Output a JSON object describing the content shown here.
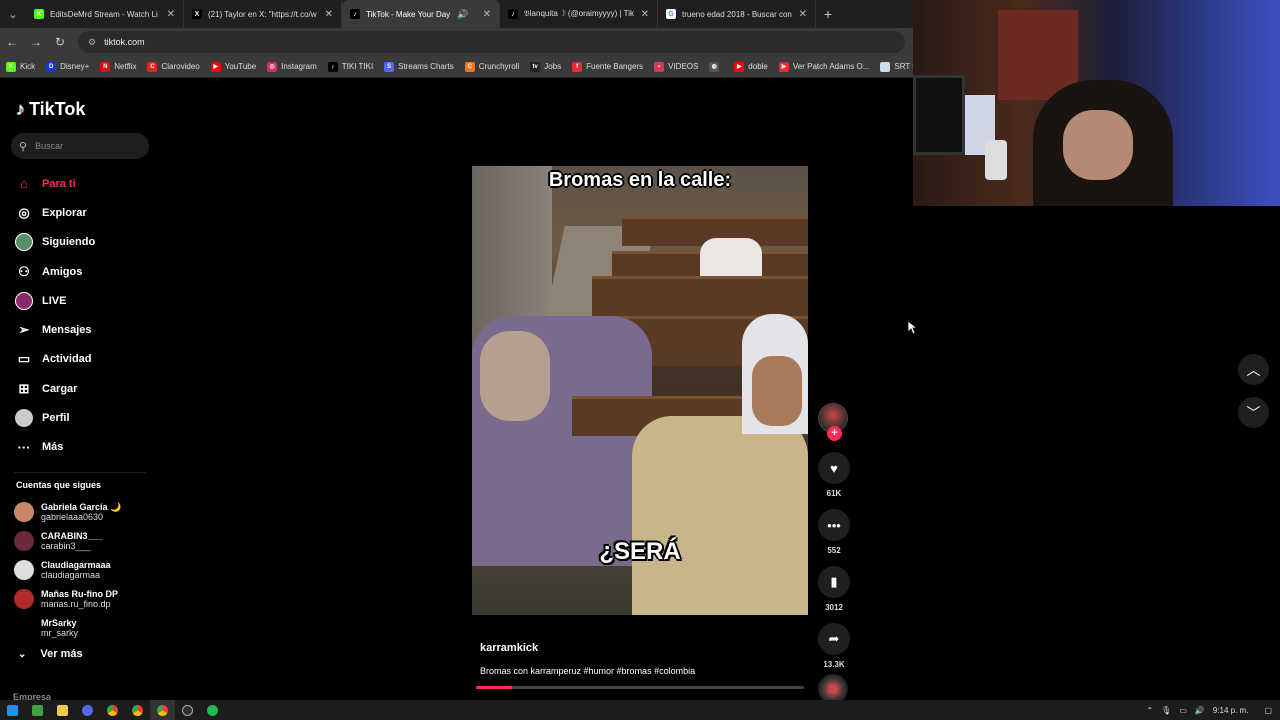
{
  "browser": {
    "tabs": [
      {
        "title": "EditsDeMrd Stream - Watch Li",
        "icon": "kick-icon",
        "color": "#53fc18",
        "glyph": "K",
        "active": false
      },
      {
        "title": "(21) Taylor en X: \"https://t.co/w",
        "icon": "x-icon",
        "color": "#000000",
        "glyph": "X",
        "active": false
      },
      {
        "title": "TikTok - Make Your Day",
        "icon": "tiktok-icon",
        "color": "#000000",
        "glyph": "♪",
        "active": true
      },
      {
        "title": "𝔅lanquita ☽ (@oraimyyyy) | Tik",
        "icon": "tiktok-icon",
        "color": "#000000",
        "glyph": "♪",
        "active": false
      },
      {
        "title": "trueno edad 2018 - Buscar con",
        "icon": "google-icon",
        "color": "#ffffff",
        "glyph": "G",
        "active": false
      }
    ],
    "url": "tiktok.com",
    "bookmarks": [
      {
        "label": "Kick",
        "color": "#53fc18",
        "glyph": "K"
      },
      {
        "label": "Disney+",
        "color": "#113ccf",
        "glyph": "D"
      },
      {
        "label": "Netflix",
        "color": "#e50914",
        "glyph": "N"
      },
      {
        "label": "Clarovideo",
        "color": "#da291c",
        "glyph": "C"
      },
      {
        "label": "YouTube",
        "color": "#ff0000",
        "glyph": "▶"
      },
      {
        "label": "Instagram",
        "color": "#d62976",
        "glyph": "◎"
      },
      {
        "label": "TIKI TIKI",
        "color": "#000000",
        "glyph": "♪"
      },
      {
        "label": "Streams Charts",
        "color": "#5566ff",
        "glyph": "S"
      },
      {
        "label": "Crunchyroll",
        "color": "#f47521",
        "glyph": "C"
      },
      {
        "label": "Jobs",
        "color": "#222222",
        "glyph": "tv"
      },
      {
        "label": "Fuente Bangers",
        "color": "#e03030",
        "glyph": "f"
      },
      {
        "label": "VIDEOS",
        "color": "#d23c5a",
        "glyph": "▪"
      },
      {
        "label": "",
        "color": "#555555",
        "glyph": "◍"
      },
      {
        "label": "doble",
        "color": "#ff0000",
        "glyph": "▶"
      },
      {
        "label": "Ver Patch Adams O...",
        "color": "#e03030",
        "glyph": "▶"
      },
      {
        "label": "SRT Mi",
        "color": "#ccddee",
        "glyph": "◌"
      }
    ]
  },
  "tiktok": {
    "logo": "TikTok",
    "search_placeholder": "Buscar",
    "nav": [
      {
        "label": "Para ti",
        "name": "nav-para-ti",
        "icon": "home-icon",
        "glyph": "⌂",
        "active": true
      },
      {
        "label": "Explorar",
        "name": "nav-explorar",
        "icon": "compass-icon",
        "glyph": "◎",
        "active": false
      },
      {
        "label": "Siguiendo",
        "name": "nav-siguiendo",
        "icon": "following-avatar-icon",
        "glyph": "",
        "active": false
      },
      {
        "label": "Amigos",
        "name": "nav-amigos",
        "icon": "friends-icon",
        "glyph": "⚇",
        "active": false
      },
      {
        "label": "LIVE",
        "name": "nav-live",
        "icon": "live-avatar-icon",
        "glyph": "",
        "active": false
      },
      {
        "label": "Mensajes",
        "name": "nav-mensajes",
        "icon": "paper-plane-icon",
        "glyph": "➢",
        "active": false
      },
      {
        "label": "Actividad",
        "name": "nav-actividad",
        "icon": "activity-icon",
        "glyph": "▭",
        "active": false
      },
      {
        "label": "Cargar",
        "name": "nav-cargar",
        "icon": "upload-icon",
        "glyph": "⊞",
        "active": false
      },
      {
        "label": "Perfil",
        "name": "nav-perfil",
        "icon": "profile-avatar-icon",
        "glyph": "",
        "active": false
      },
      {
        "label": "Más",
        "name": "nav-mas",
        "icon": "more-icon",
        "glyph": "···",
        "active": false
      }
    ],
    "following_title": "Cuentas que sigues",
    "following": [
      {
        "name": "Gabriela García 🌙",
        "user": "gabrielaaa0630",
        "color": "#c98a6a"
      },
      {
        "name": "CARABIN3___",
        "user": "carabin3___",
        "color": "#6a2a3a"
      },
      {
        "name": "Claudiagarmaaa",
        "user": "claudiagarmaa",
        "color": "#dddddd"
      },
      {
        "name": "Mañas Ru-fino DP",
        "user": "manas.ru_fino.dp",
        "color": "#b02a2a"
      },
      {
        "name": "MrSarky",
        "user": "mr_sarky",
        "color": "#000000"
      }
    ],
    "ver_mas": "Ver más",
    "empresa": "Empresa",
    "video": {
      "caption_top": "Bromas en la calle:",
      "caption_mid": "¿SERÁ",
      "author": "karramkick",
      "description": "Bromas con karramperuz #humor #bromas #colombia",
      "progress": 0.11
    },
    "actions": {
      "likes": "61K",
      "comments": "552",
      "saves": "3012",
      "shares": "13.3K"
    }
  },
  "taskbar": {
    "time": "9:14 p. m."
  }
}
